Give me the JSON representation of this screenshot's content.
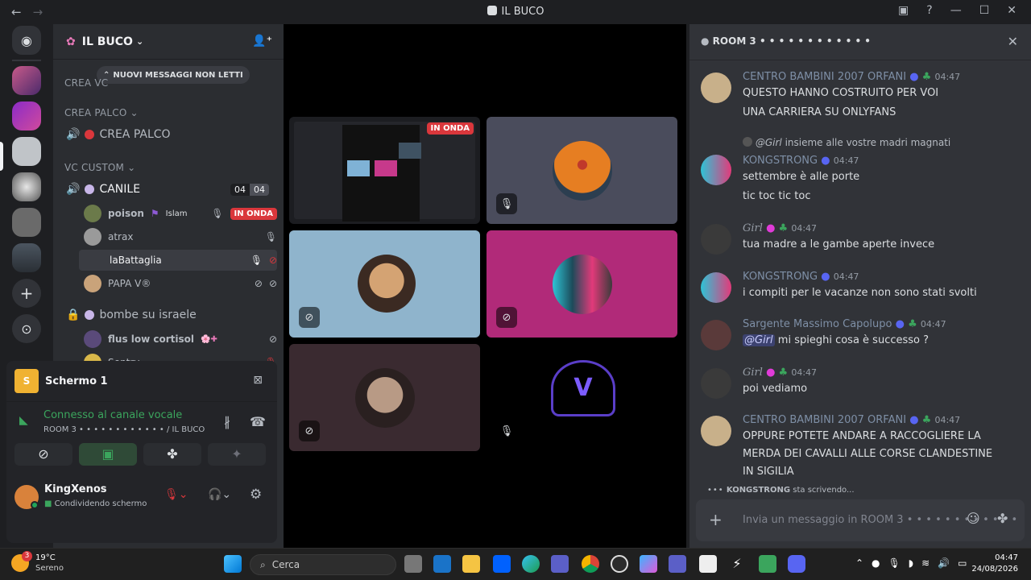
{
  "window": {
    "title": "IL BUCO"
  },
  "server": {
    "name": "IL BUCO",
    "unread_banner": "NUOVI MESSAGGI NON LETTI"
  },
  "categories": {
    "crea_vc": "CREA VC",
    "crea_palco": "CREA PALCO",
    "vc_custom": "VC CUSTOM"
  },
  "channels": {
    "crea_palco": "CREA PALCO",
    "canile": "CANILE",
    "canile_count_a": "04",
    "canile_count_b": "04",
    "bombe": "bombe su israele"
  },
  "users": [
    {
      "name": "poison",
      "tag": "Islam",
      "live": "IN ONDA"
    },
    {
      "name": "atrax"
    },
    {
      "name": "laBattaglia"
    },
    {
      "name": "PAPA V®"
    },
    {
      "name": "flus low cortisol",
      "tag": "🌸✚"
    },
    {
      "name": "Sentry"
    }
  ],
  "panel": {
    "screen_title": "Schermo 1",
    "voice_status": "Connesso al canale vocale",
    "voice_room": "ROOM 3 • • • • • • • • • • • • / IL BUCO",
    "user": "KingXenos",
    "user_status": "Condividendo schermo"
  },
  "stage": {
    "live_badge": "IN ONDA"
  },
  "chat": {
    "room": "ROOM 3 • • • • • • • • • • • •",
    "messages": [
      {
        "author": "CENTRO BAMBINI 2007 ORFANI",
        "time": "04:47",
        "lines": [
          "QUESTO HANNO COSTRUITO PER VOI",
          "UNA CARRIERA SU ONLYFANS"
        ]
      },
      {
        "reply_author": "@Girl",
        "reply_text": "insieme alle vostre madri magnati",
        "author": "KONGSTRONG",
        "time": "04:47",
        "lines": [
          "settembre è alle porte",
          "tic toc tic toc"
        ]
      },
      {
        "author": "Girl",
        "time": "04:47",
        "lines": [
          "tua madre a le gambe aperte invece"
        ]
      },
      {
        "author": "KONGSTRONG",
        "time": "04:47",
        "lines": [
          "i compiti per le vacanze non sono stati svolti"
        ]
      },
      {
        "author": "Sargente Massimo Capolupo",
        "time": "04:47",
        "mention": "@Girl",
        "lines": [
          "mi spieghi cosa è successo ?"
        ]
      },
      {
        "author": "Girl",
        "time": "04:47",
        "lines": [
          "poi vediamo"
        ]
      },
      {
        "author": "CENTRO BAMBINI 2007 ORFANI",
        "time": "04:47",
        "lines": [
          "OPPURE POTETE ANDARE A RACCOGLIERE LA",
          "MERDA DEI CAVALLI ALLE CORSE CLANDESTINE",
          "IN SIGILIA"
        ]
      }
    ],
    "typing_user": "KONGSTRONG",
    "typing_text": "sta scrivendo...",
    "input_placeholder": "Invia un messaggio in ROOM 3 • • • • • • • • • • • •"
  },
  "taskbar": {
    "temp": "19°C",
    "weather": "Sereno",
    "search": "Cerca",
    "time": "04:47",
    "date": "24/08/2026",
    "weather_badge": "3"
  }
}
